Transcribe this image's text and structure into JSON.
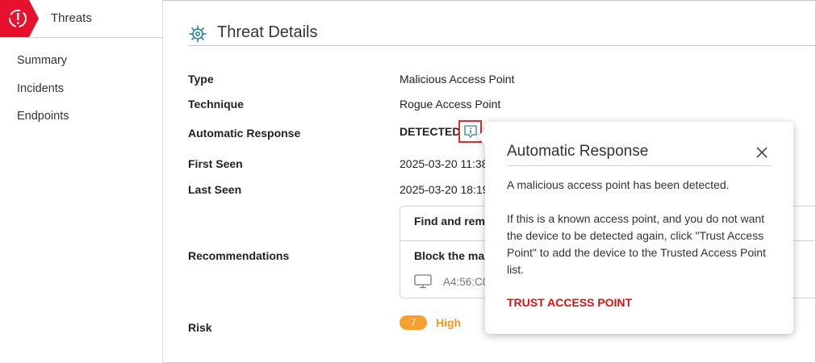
{
  "sidebar": {
    "title": "Threats",
    "items": [
      {
        "label": "Summary"
      },
      {
        "label": "Incidents"
      },
      {
        "label": "Endpoints"
      }
    ]
  },
  "page": {
    "title": "Threat Details"
  },
  "details": {
    "type_label": "Type",
    "type_value": "Malicious Access Point",
    "technique_label": "Technique",
    "technique_value": "Rogue Access Point",
    "response_label": "Automatic Response",
    "response_value": "DETECTED",
    "first_seen_label": "First Seen",
    "first_seen_value": "2025-03-20 11:38",
    "last_seen_label": "Last Seen",
    "last_seen_value": "2025-03-20 18:19",
    "recommendations_label": "Recommendations",
    "risk_label": "Risk",
    "risk_score": "7",
    "risk_level": "High"
  },
  "recommendations": {
    "item1": "Find and rem",
    "item2": "Block the ma",
    "device_mac": "A4:56:C0"
  },
  "popover": {
    "title": "Automatic Response",
    "text1": "A malicious access point has been detected.",
    "text2": "If this is a known access point, and you do not want the device to be detected again, click \"Trust Access Point\" to add the device to the Trusted Access Point list.",
    "action": "TRUST ACCESS POINT"
  },
  "colors": {
    "brand_red": "#e8112d",
    "risk_orange": "#f7a032",
    "action_red": "#e01010",
    "icon_teal": "#2f7fa0"
  },
  "icons": {
    "logo": "threat-alert-icon",
    "heading": "gear-icon",
    "info": "info-icon",
    "close": "close-icon",
    "device": "monitor-icon"
  }
}
